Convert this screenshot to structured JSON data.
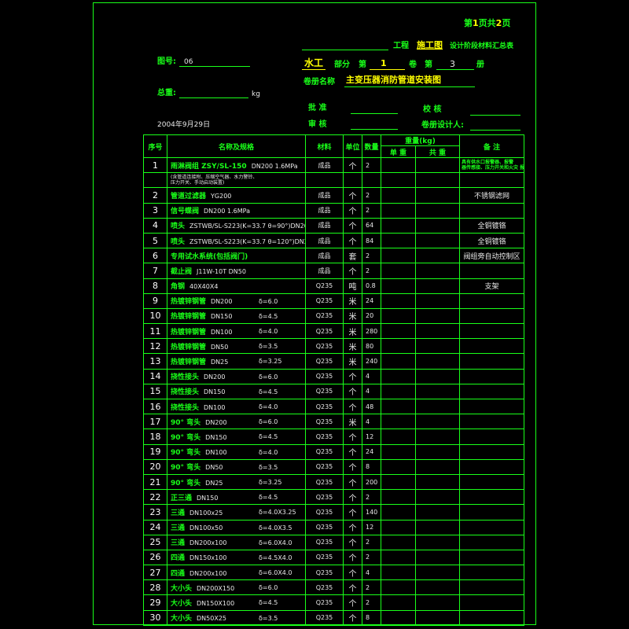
{
  "header": {
    "page_prefix": "第",
    "page_no": "1",
    "page_mid": "页共",
    "page_total": "2",
    "page_suffix": "页",
    "project_label": "工程",
    "stage": "施工图",
    "summary_title": "设计阶段材料汇总表",
    "drawing_no_label": "图号:",
    "drawing_no": "06",
    "discipline": "水工",
    "part_label": "部分",
    "vol_label": "第",
    "vol_no": "1",
    "vol_mid": "卷",
    "book_label": "第",
    "book_no": "3",
    "book_suffix": "册",
    "volume_name_label": "卷册名称",
    "volume_name": "主变压器消防管道安装图",
    "total_weight_label": "总重:",
    "weight_unit": "kg",
    "approve_label": "批  准",
    "check_label": "校  核",
    "review_label": "审  核",
    "designer_label": "卷册设计人:",
    "date": "2004年9月29日"
  },
  "columns": {
    "no": "序号",
    "name": "名称及规格",
    "material": "材料",
    "unit": "单位",
    "qty": "数量",
    "weight": "重量(kg)",
    "unit_weight": "单 重",
    "total_weight": "共 重",
    "remark": "备  注"
  },
  "rows": [
    {
      "no": "1",
      "name": "雨淋阀组 ZSY/SL-150",
      "spec": "DN200 1.6MPa",
      "thick": "",
      "mat": "成品",
      "unit": "个",
      "qty": "2",
      "remark": "具有供水口报警器、报警\n器传感接、压力开关和火灾 报"
    },
    {
      "no": "",
      "name": "(含管道连接附、压缩空气器、水力警铃、",
      "spec": "",
      "thick": "",
      "mat": "",
      "unit": "",
      "qty": "",
      "remark": "",
      "sub": "压力开关、手动启动装置)"
    },
    {
      "no": "2",
      "name": "管道过滤器",
      "spec": "YG200",
      "thick": "",
      "mat": "成品",
      "unit": "个",
      "qty": "2",
      "remark": "不锈钢滤网"
    },
    {
      "no": "3",
      "name": "信号蝶阀",
      "spec": "DN200    1.6MPa",
      "thick": "",
      "mat": "成品",
      "unit": "个",
      "qty": "2",
      "remark": ""
    },
    {
      "no": "4",
      "name": "喷头",
      "spec": "ZSTWB/SL-S223(K=33.7  θ=90°)DN20",
      "thick": "",
      "mat": "成品",
      "unit": "个",
      "qty": "64",
      "remark": "全铜镀铬"
    },
    {
      "no": "5",
      "name": "喷头",
      "spec": "ZSTWB/SL-S223(K=33.7  θ=120°)DN20",
      "thick": "",
      "mat": "成品",
      "unit": "个",
      "qty": "84",
      "remark": "全铜镀铬"
    },
    {
      "no": "6",
      "name": "专用试水系统(包括阀门)",
      "spec": "",
      "thick": "",
      "mat": "成品",
      "unit": "套",
      "qty": "2",
      "remark": "阀组旁自动控制区"
    },
    {
      "no": "7",
      "name": "截止阀",
      "spec": "J11W-10T DN50",
      "thick": "",
      "mat": "成品",
      "unit": "个",
      "qty": "2",
      "remark": ""
    },
    {
      "no": "8",
      "name": "角钢",
      "spec": "40X40X4",
      "thick": "",
      "mat": "Q235",
      "unit": "吨",
      "qty": "0.8",
      "remark": "支架"
    },
    {
      "no": "9",
      "name": "热镀锌钢管",
      "spec": "DN200",
      "thick": "δ=6.0",
      "mat": "Q235",
      "unit": "米",
      "qty": "24",
      "remark": ""
    },
    {
      "no": "10",
      "name": "热镀锌钢管",
      "spec": "DN150",
      "thick": "δ=4.5",
      "mat": "Q235",
      "unit": "米",
      "qty": "20",
      "remark": ""
    },
    {
      "no": "11",
      "name": "热镀锌钢管",
      "spec": "DN100",
      "thick": "δ=4.0",
      "mat": "Q235",
      "unit": "米",
      "qty": "280",
      "remark": ""
    },
    {
      "no": "12",
      "name": "热镀锌钢管",
      "spec": "DN50",
      "thick": "δ=3.5",
      "mat": "Q235",
      "unit": "米",
      "qty": "80",
      "remark": ""
    },
    {
      "no": "13",
      "name": "热镀锌钢管",
      "spec": "DN25",
      "thick": "δ=3.25",
      "mat": "Q235",
      "unit": "米",
      "qty": "240",
      "remark": ""
    },
    {
      "no": "14",
      "name": "挠性接头",
      "spec": "DN200",
      "thick": "δ=6.0",
      "mat": "Q235",
      "unit": "个",
      "qty": "4",
      "remark": ""
    },
    {
      "no": "15",
      "name": "挠性接头",
      "spec": "DN150",
      "thick": "δ=4.5",
      "mat": "Q235",
      "unit": "个",
      "qty": "4",
      "remark": ""
    },
    {
      "no": "16",
      "name": "挠性接头",
      "spec": "DN100",
      "thick": "δ=4.0",
      "mat": "Q235",
      "unit": "个",
      "qty": "48",
      "remark": ""
    },
    {
      "no": "17",
      "name": "90° 弯头",
      "spec": "DN200",
      "thick": "δ=6.0",
      "mat": "Q235",
      "unit": "米",
      "qty": "4",
      "remark": ""
    },
    {
      "no": "18",
      "name": "90° 弯头",
      "spec": "DN150",
      "thick": "δ=4.5",
      "mat": "Q235",
      "unit": "个",
      "qty": "12",
      "remark": ""
    },
    {
      "no": "19",
      "name": "90° 弯头",
      "spec": "DN100",
      "thick": "δ=4.0",
      "mat": "Q235",
      "unit": "个",
      "qty": "24",
      "remark": ""
    },
    {
      "no": "20",
      "name": "90° 弯头",
      "spec": "DN50",
      "thick": "δ=3.5",
      "mat": "Q235",
      "unit": "个",
      "qty": "8",
      "remark": ""
    },
    {
      "no": "21",
      "name": "90° 弯头",
      "spec": "DN25",
      "thick": "δ=3.25",
      "mat": "Q235",
      "unit": "个",
      "qty": "200",
      "remark": ""
    },
    {
      "no": "22",
      "name": "正三通",
      "spec": "DN150",
      "thick": "δ=4.5",
      "mat": "Q235",
      "unit": "个",
      "qty": "2",
      "remark": ""
    },
    {
      "no": "23",
      "name": "三通",
      "spec": "DN100x25",
      "thick": "δ=4.0X3.25",
      "mat": "Q235",
      "unit": "个",
      "qty": "140",
      "remark": ""
    },
    {
      "no": "24",
      "name": "三通",
      "spec": "DN100x50",
      "thick": "δ=4.0X3.5",
      "mat": "Q235",
      "unit": "个",
      "qty": "12",
      "remark": ""
    },
    {
      "no": "25",
      "name": "三通",
      "spec": "DN200x100",
      "thick": "δ=6.0X4.0",
      "mat": "Q235",
      "unit": "个",
      "qty": "2",
      "remark": ""
    },
    {
      "no": "26",
      "name": "四通",
      "spec": "DN150x100",
      "thick": "δ=4.5X4.0",
      "mat": "Q235",
      "unit": "个",
      "qty": "2",
      "remark": ""
    },
    {
      "no": "27",
      "name": "四通",
      "spec": "DN200x100",
      "thick": "δ=6.0X4.0",
      "mat": "Q235",
      "unit": "个",
      "qty": "4",
      "remark": ""
    },
    {
      "no": "28",
      "name": "大小头",
      "spec": "DN200X150",
      "thick": "δ=6.0",
      "mat": "Q235",
      "unit": "个",
      "qty": "2",
      "remark": ""
    },
    {
      "no": "29",
      "name": "大小头",
      "spec": "DN150X100",
      "thick": "δ=4.5",
      "mat": "Q235",
      "unit": "个",
      "qty": "2",
      "remark": ""
    },
    {
      "no": "30",
      "name": "大小头",
      "spec": "DN50X25",
      "thick": "δ=3.5",
      "mat": "Q235",
      "unit": "个",
      "qty": "8",
      "remark": ""
    }
  ]
}
